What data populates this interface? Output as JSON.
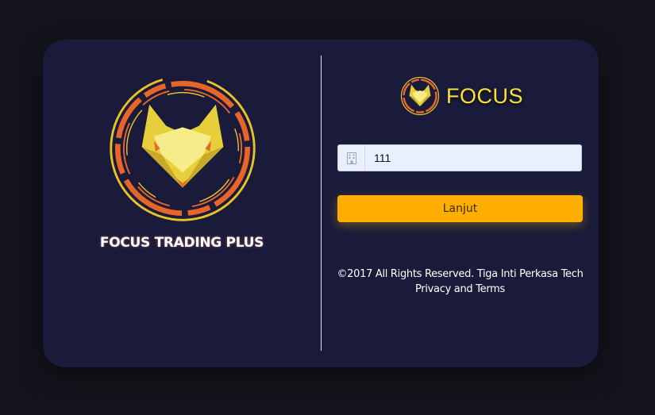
{
  "left_panel": {
    "title": "FOCUS TRADING PLUS"
  },
  "brand": {
    "name": "FOCUS"
  },
  "form": {
    "code_value": "111",
    "submit_label": "Lanjut"
  },
  "footer": {
    "copyright": "©2017 All Rights Reserved. Tiga Inti Perkasa Tech",
    "privacy_link": "Privacy and Terms"
  },
  "colors": {
    "page_bg": "#14141c",
    "card_bg": "#1a1b3a",
    "accent_yellow": "#ffae00",
    "brand_yellow": "#f6e33a",
    "ring_orange": "#e8652a",
    "ring_gold": "#e8c22a"
  },
  "icons": {
    "logo": "fox-shield-logo",
    "input": "building-icon"
  }
}
